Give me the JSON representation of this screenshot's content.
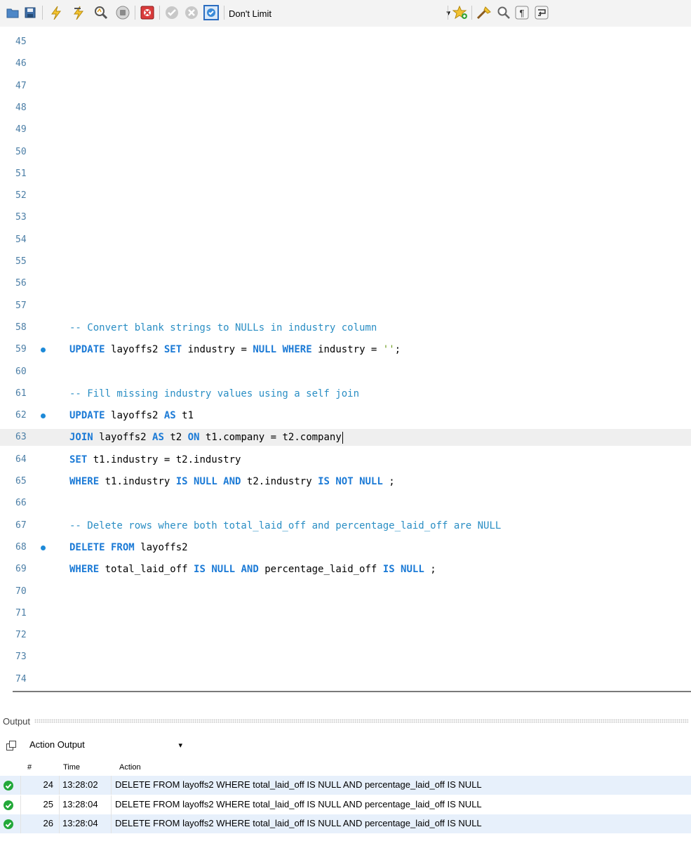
{
  "toolbar": {
    "limit_value": "Don't Limit",
    "icons": [
      "open-file-icon",
      "save-icon",
      "execute-icon",
      "execute-current-icon",
      "explain-icon",
      "stop-icon",
      "stop-on-error-icon",
      "commit-icon",
      "rollback-icon",
      "autocommit-icon",
      "add-snippet-icon",
      "beautify-icon",
      "find-icon",
      "invisibles-icon",
      "wrap-icon"
    ]
  },
  "editor": {
    "lines": [
      {
        "n": "45"
      },
      {
        "n": "46"
      },
      {
        "n": "47"
      },
      {
        "n": "48"
      },
      {
        "n": "49"
      },
      {
        "n": "50"
      },
      {
        "n": "51"
      },
      {
        "n": "52"
      },
      {
        "n": "53"
      },
      {
        "n": "54"
      },
      {
        "n": "55"
      },
      {
        "n": "56"
      },
      {
        "n": "57"
      },
      {
        "n": "58",
        "tokens": [
          [
            "cm",
            "-- Convert blank strings to NULLs in industry column"
          ]
        ]
      },
      {
        "n": "59",
        "dot": true,
        "tokens": [
          [
            "kw",
            "UPDATE"
          ],
          [
            "",
            "layoffs2 "
          ],
          [
            "kw",
            "SET"
          ],
          [
            "",
            "industry = "
          ],
          [
            "kw",
            "NULL"
          ],
          [
            "",
            ""
          ],
          [
            "kw",
            "WHERE"
          ],
          [
            "",
            "industry = "
          ],
          [
            "st",
            "''"
          ],
          [
            "",
            ";"
          ]
        ]
      },
      {
        "n": "60"
      },
      {
        "n": "61",
        "tokens": [
          [
            "cm",
            "-- Fill missing industry values using a self join"
          ]
        ]
      },
      {
        "n": "62",
        "dot": true,
        "tokens": [
          [
            "kw",
            "UPDATE"
          ],
          [
            "",
            "layoffs2 "
          ],
          [
            "kw",
            "AS"
          ],
          [
            "",
            "t1"
          ]
        ]
      },
      {
        "n": "63",
        "current": true,
        "tokens": [
          [
            "kw",
            "JOIN"
          ],
          [
            "",
            "layoffs2 "
          ],
          [
            "kw",
            "AS"
          ],
          [
            "",
            "t2 "
          ],
          [
            "kw",
            "ON"
          ],
          [
            "",
            "t1.company = t2.company"
          ]
        ]
      },
      {
        "n": "64",
        "tokens": [
          [
            "kw",
            "SET"
          ],
          [
            "",
            "t1.industry = t2.industry"
          ]
        ]
      },
      {
        "n": "65",
        "tokens": [
          [
            "kw",
            "WHERE"
          ],
          [
            "",
            "t1.industry "
          ],
          [
            "kw",
            "IS NULL AND"
          ],
          [
            "",
            "t2.industry "
          ],
          [
            "kw",
            "IS NOT NULL"
          ],
          [
            "",
            ";"
          ]
        ]
      },
      {
        "n": "66"
      },
      {
        "n": "67",
        "tokens": [
          [
            "cm",
            "-- Delete rows where both total_laid_off and percentage_laid_off are NULL"
          ]
        ]
      },
      {
        "n": "68",
        "dot": true,
        "tokens": [
          [
            "kw",
            "DELETE FROM"
          ],
          [
            "",
            "layoffs2"
          ]
        ]
      },
      {
        "n": "69",
        "tokens": [
          [
            "kw",
            "WHERE"
          ],
          [
            "",
            "total_laid_off "
          ],
          [
            "kw",
            "IS NULL AND"
          ],
          [
            "",
            "percentage_laid_off "
          ],
          [
            "kw",
            "IS NULL"
          ],
          [
            "",
            ";"
          ]
        ]
      },
      {
        "n": "70"
      },
      {
        "n": "71"
      },
      {
        "n": "72"
      },
      {
        "n": "73"
      },
      {
        "n": "74"
      }
    ]
  },
  "output": {
    "title": "Output",
    "selector": "Action Output",
    "columns": {
      "num": "#",
      "time": "Time",
      "action": "Action"
    },
    "rows": [
      {
        "num": "24",
        "time": "13:28:02",
        "action": "DELETE FROM layoffs2 WHERE total_laid_off IS NULL AND percentage_laid_off IS NULL"
      },
      {
        "num": "25",
        "time": "13:28:04",
        "action": "DELETE FROM layoffs2 WHERE total_laid_off IS NULL AND percentage_laid_off IS NULL"
      },
      {
        "num": "26",
        "time": "13:28:04",
        "action": "DELETE FROM layoffs2 WHERE total_laid_off IS NULL AND percentage_laid_off IS NULL"
      }
    ]
  }
}
